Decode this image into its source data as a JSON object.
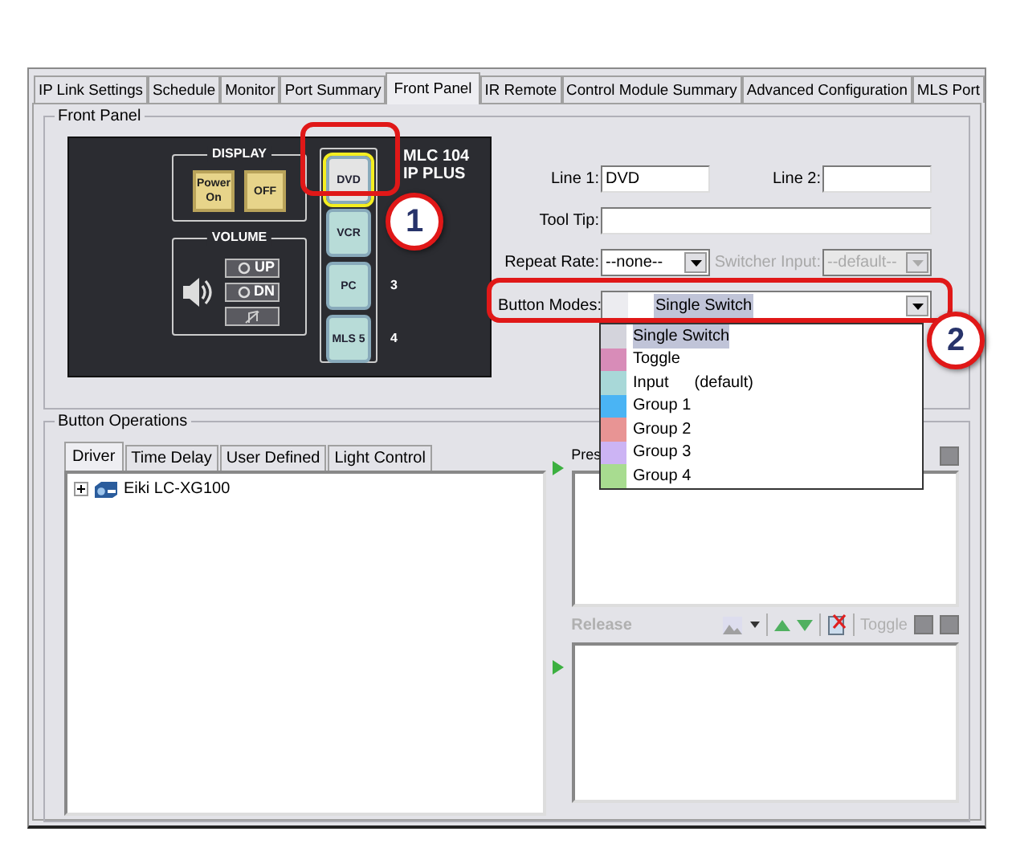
{
  "tabs": [
    {
      "label": "IP Link Settings",
      "selected": false
    },
    {
      "label": "Schedule",
      "selected": false
    },
    {
      "label": "Monitor",
      "selected": false
    },
    {
      "label": "Port Summary",
      "selected": false
    },
    {
      "label": "Front Panel",
      "selected": true
    },
    {
      "label": "IR Remote",
      "selected": false
    },
    {
      "label": "Control Module Summary",
      "selected": false
    },
    {
      "label": "Advanced Configuration",
      "selected": false
    },
    {
      "label": "MLS Port",
      "selected": false
    }
  ],
  "front_panel": {
    "title": "Front Panel",
    "device": {
      "display_label": "DISPLAY",
      "display_buttons": [
        "Power On",
        "OFF"
      ],
      "volume_label": "VOLUME",
      "volume_buttons": [
        "UP",
        "DN"
      ],
      "model_lines": [
        "MLC 104",
        "IP PLUS"
      ],
      "input_buttons": [
        {
          "label": "DVD",
          "selected": true
        },
        {
          "label": "VCR",
          "selected": false
        },
        {
          "label": "PC",
          "number": "3",
          "selected": false
        },
        {
          "label": "MLS 5",
          "number": "4",
          "selected": false
        }
      ]
    },
    "line_1": {
      "label": "Line 1:",
      "value": "DVD"
    },
    "line_2": {
      "label": "Line 2:"
    },
    "tool_tip": {
      "label": "Tool Tip:"
    },
    "repeat_rate": {
      "label": "Repeat Rate:",
      "value": "--none--",
      "disabled": false
    },
    "switcher_input": {
      "label": "Switcher Input:",
      "value": "--default--",
      "disabled": true
    },
    "button_modes": {
      "label": "Button Modes:",
      "value": "Single Switch",
      "expanded": true,
      "options": [
        {
          "label": "Single Switch",
          "color": "#d4d4dc",
          "selected": true
        },
        {
          "label": "Toggle",
          "color": "#d88cb8",
          "selected": false
        },
        {
          "label": "Input",
          "note": "(default)",
          "color": "#a8d8d8",
          "selected": false
        },
        {
          "label": "Group 1",
          "color": "#4ab4f4",
          "selected": false
        },
        {
          "label": "Group 2",
          "color": "#e89494",
          "selected": false
        },
        {
          "label": "Group 3",
          "color": "#ccb4f4",
          "selected": false
        },
        {
          "label": "Group 4",
          "color": "#a8dc90",
          "selected": false
        }
      ]
    }
  },
  "button_operations": {
    "title": "Button Operations",
    "tabs": [
      {
        "label": "Driver",
        "selected": true
      },
      {
        "label": "Time Delay",
        "selected": false
      },
      {
        "label": "User Defined",
        "selected": false
      },
      {
        "label": "Light Control",
        "selected": false
      }
    ],
    "tree": [
      {
        "label": "Eiki LC-XG100",
        "expanded": false
      }
    ],
    "press": {
      "label": "Pres"
    },
    "release": {
      "label": "Release",
      "disabled": true,
      "toggle_label": "Toggle"
    }
  },
  "callouts": [
    "1",
    "2"
  ]
}
